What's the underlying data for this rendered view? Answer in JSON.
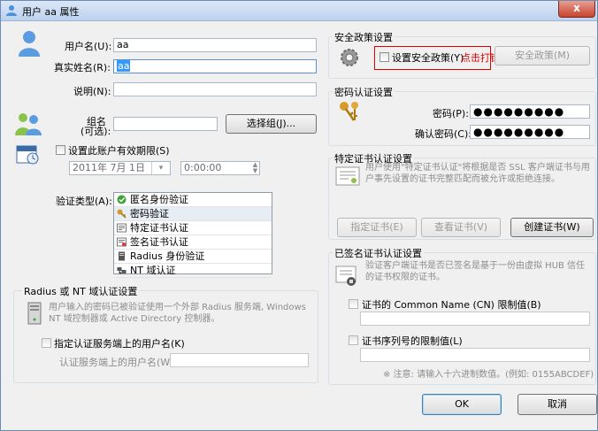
{
  "window": {
    "title": "用户 aa 属性",
    "close": "x"
  },
  "user": {
    "username_label": "用户名(U):",
    "username": "aa",
    "realname_label": "真实姓名(R):",
    "realname": "aa",
    "desc_label": "说明(N):",
    "desc": ""
  },
  "group": {
    "label_line1": "组名",
    "label_line2": "(可选):",
    "value": "",
    "select_button": "选择组(J)..."
  },
  "expiry": {
    "checkbox_label": "设置此账户有效期限(S)",
    "date": "2011年  7月  1日",
    "time": "0:00:00"
  },
  "auth": {
    "label": "验证类型(A):",
    "items": [
      "匿名身份验证",
      "密码验证",
      "特定证书认证",
      "签名证书认证",
      "Radius 身份验证",
      "NT 域认证"
    ]
  },
  "radius": {
    "title": "Radius 或 NT 域认证设置",
    "hint": "用户输入的密码已被验证使用一个外部 Radius 服务端, Windows NT 域控制器或 Active Directory 控制器。",
    "checkbox_label": "指定认证服务端上的用户名(K)",
    "server_user_label": "认证服务端上的用户名(W):"
  },
  "security": {
    "title": "安全政策设置",
    "checkbox_label": "设置安全政策(Y)",
    "annotation": "点击打钩",
    "button": "安全政策(M)"
  },
  "password": {
    "title": "密码认证设置",
    "pw_label": "密码(P):",
    "pw": "●●●●●●●●●",
    "confirm_label": "确认密码(C):",
    "confirm": "●●●●●●●●●"
  },
  "cert": {
    "title": "特定证书认证设置",
    "hint": "用户使用\"特定证书认证\"将根据是否 SSL 客户端证书与用户事先设置的证书完整匹配而被允许或拒绝连接。",
    "btn_specify": "指定证书(E)",
    "btn_view": "查看证书(V)",
    "btn_create": "创建证书(W)"
  },
  "signed": {
    "title": "已签名证书认证设置",
    "hint": "验证客户端证书是否已签名是基于一份由虚拟 HUB 信任的证书权限的证书。",
    "cn_label": "证书的 Common Name (CN) 限制值(B)",
    "serial_label": "证书序列号的限制值(L)",
    "note": "※ 注意: 请输入十六进制数值。(例如: 0155ABCDEF)"
  },
  "footer": {
    "ok": "OK",
    "cancel": "取消"
  },
  "colors": {
    "annotation_red": "#e00000",
    "accent_blue": "#3399ff"
  }
}
